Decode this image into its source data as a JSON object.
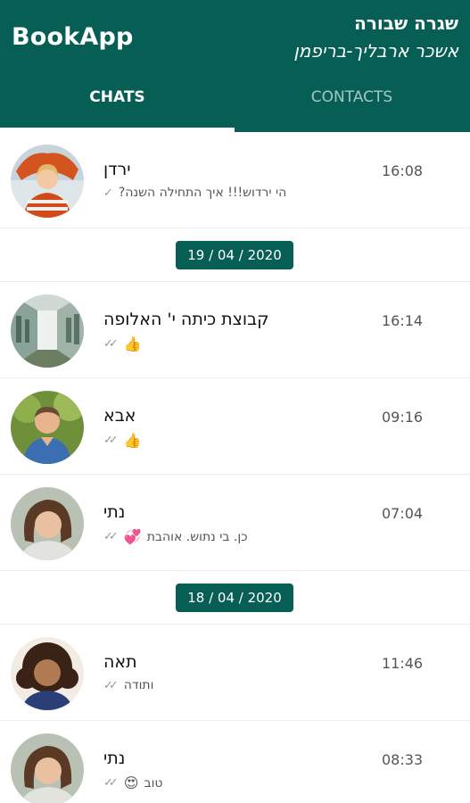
{
  "header": {
    "app_title": "BookApp",
    "book_title": "שגרה שבורה",
    "book_author": "אשכר ארבליך-בריפמן",
    "color": "#075e54"
  },
  "tabs": [
    {
      "label": "CHATS",
      "active": true
    },
    {
      "label": "CONTACTS",
      "active": false
    }
  ],
  "chats_top": [
    {
      "name": "ירדן",
      "time": "16:08",
      "ticks": "✓",
      "emoji": "",
      "message": "הי ירדוש!!! איך התחילה השנה?"
    }
  ],
  "date_separators": [
    "19 / 04 / 2020",
    "18 / 04 / 2020"
  ],
  "chats_apr19": [
    {
      "name": "קבוצת כיתה י' האלופה",
      "time": "16:14",
      "ticks": "✓✓",
      "emoji": "👍",
      "message": ""
    },
    {
      "name": "אבא",
      "time": "09:16",
      "ticks": "✓✓",
      "emoji": "👍",
      "message": ""
    },
    {
      "name": "נתי",
      "time": "07:04",
      "ticks": "✓✓",
      "emoji": "💞",
      "message": "כן. בי נתוש. אוהבת"
    }
  ],
  "chats_apr18": [
    {
      "name": "תאה",
      "time": "11:46",
      "ticks": "✓✓",
      "emoji": "",
      "message": "ותודה"
    },
    {
      "name": "נתי",
      "time": "08:33",
      "ticks": "✓✓",
      "emoji": "😍",
      "message": "טוב"
    }
  ]
}
